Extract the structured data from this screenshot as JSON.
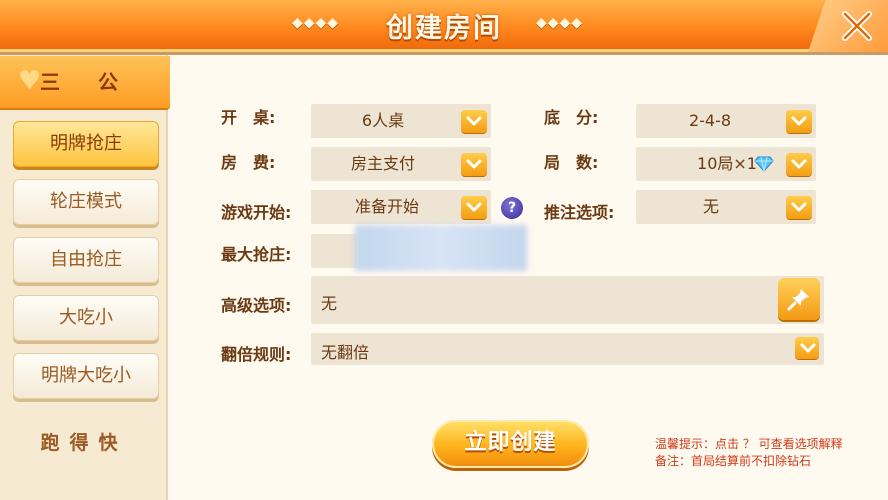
{
  "window": {
    "title": "创建房间",
    "title_deco_left": "◆◆◆◆",
    "title_deco_right": "◆◆◆◆"
  },
  "sidebar": {
    "header": "三公",
    "items": [
      {
        "label": "明牌抢庄",
        "active": true
      },
      {
        "label": "轮庄模式",
        "active": false
      },
      {
        "label": "自由抢庄",
        "active": false
      },
      {
        "label": "大吃小",
        "active": false
      },
      {
        "label": "明牌大吃小",
        "active": false
      }
    ],
    "footer": "跑得快"
  },
  "form": {
    "table": {
      "label": "开　桌:",
      "value": "6人桌"
    },
    "base_score": {
      "label": "底　分:",
      "value": "2-4-8"
    },
    "fee": {
      "label": "房　费:",
      "value": "房主支付"
    },
    "rounds": {
      "label": "局　数:",
      "value": "10局×1"
    },
    "game_start": {
      "label": "游戏开始:",
      "value": "准备开始"
    },
    "bet_option": {
      "label": "推注选项:",
      "value": "无"
    },
    "max_banker": {
      "label": "最大抢庄:"
    },
    "advanced": {
      "label": "高级选项:",
      "value": "无"
    },
    "double_rule": {
      "label": "翻倍规则:",
      "value": "无翻倍"
    }
  },
  "help_icon": "?",
  "create_button": "立即创建",
  "tips": {
    "line1": "温馨提示：点击 ？ 可查看选项解释",
    "line2": "备注：首局结算前不扣除钻石"
  },
  "icons": {
    "close": "close-icon",
    "dropdown": "chevron-down-icon",
    "diamond": "diamond-icon",
    "pin": "pin-icon",
    "heart": "heart-icon"
  },
  "colors": {
    "accent": "#ff9a1f",
    "panel": "#fbf4e6",
    "text": "#6b3a12",
    "tip": "#d03a1a"
  }
}
